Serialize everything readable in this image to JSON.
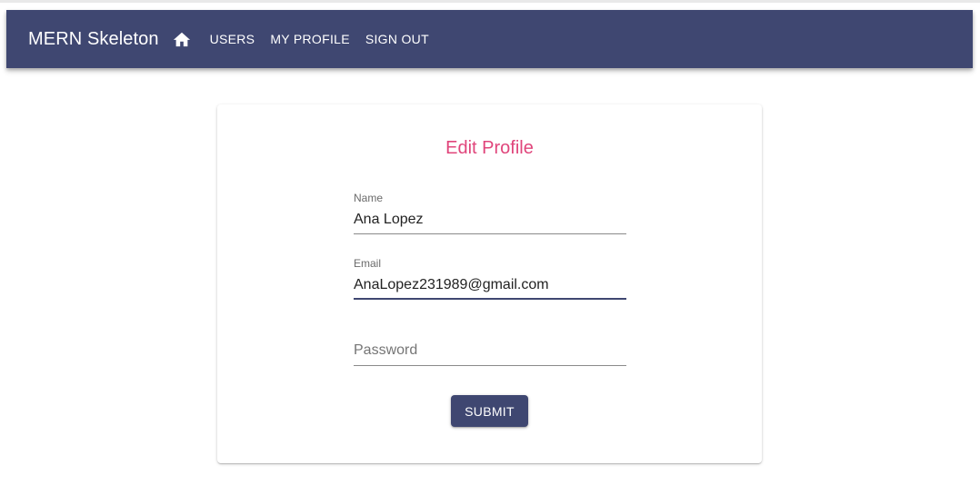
{
  "appbar": {
    "title": "MERN Skeleton",
    "home_icon": "home-icon",
    "links": [
      {
        "label": "USERS"
      },
      {
        "label": "MY PROFILE"
      },
      {
        "label": "SIGN OUT"
      }
    ],
    "color": "#3f4771"
  },
  "form": {
    "title": "Edit Profile",
    "title_color": "#e0457b",
    "name": {
      "label": "Name",
      "value": "Ana Lopez"
    },
    "email": {
      "label": "Email",
      "value": "AnaLopez231989@gmail.com"
    },
    "password": {
      "placeholder": "Password",
      "value": ""
    },
    "submit_label": "SUBMIT"
  }
}
